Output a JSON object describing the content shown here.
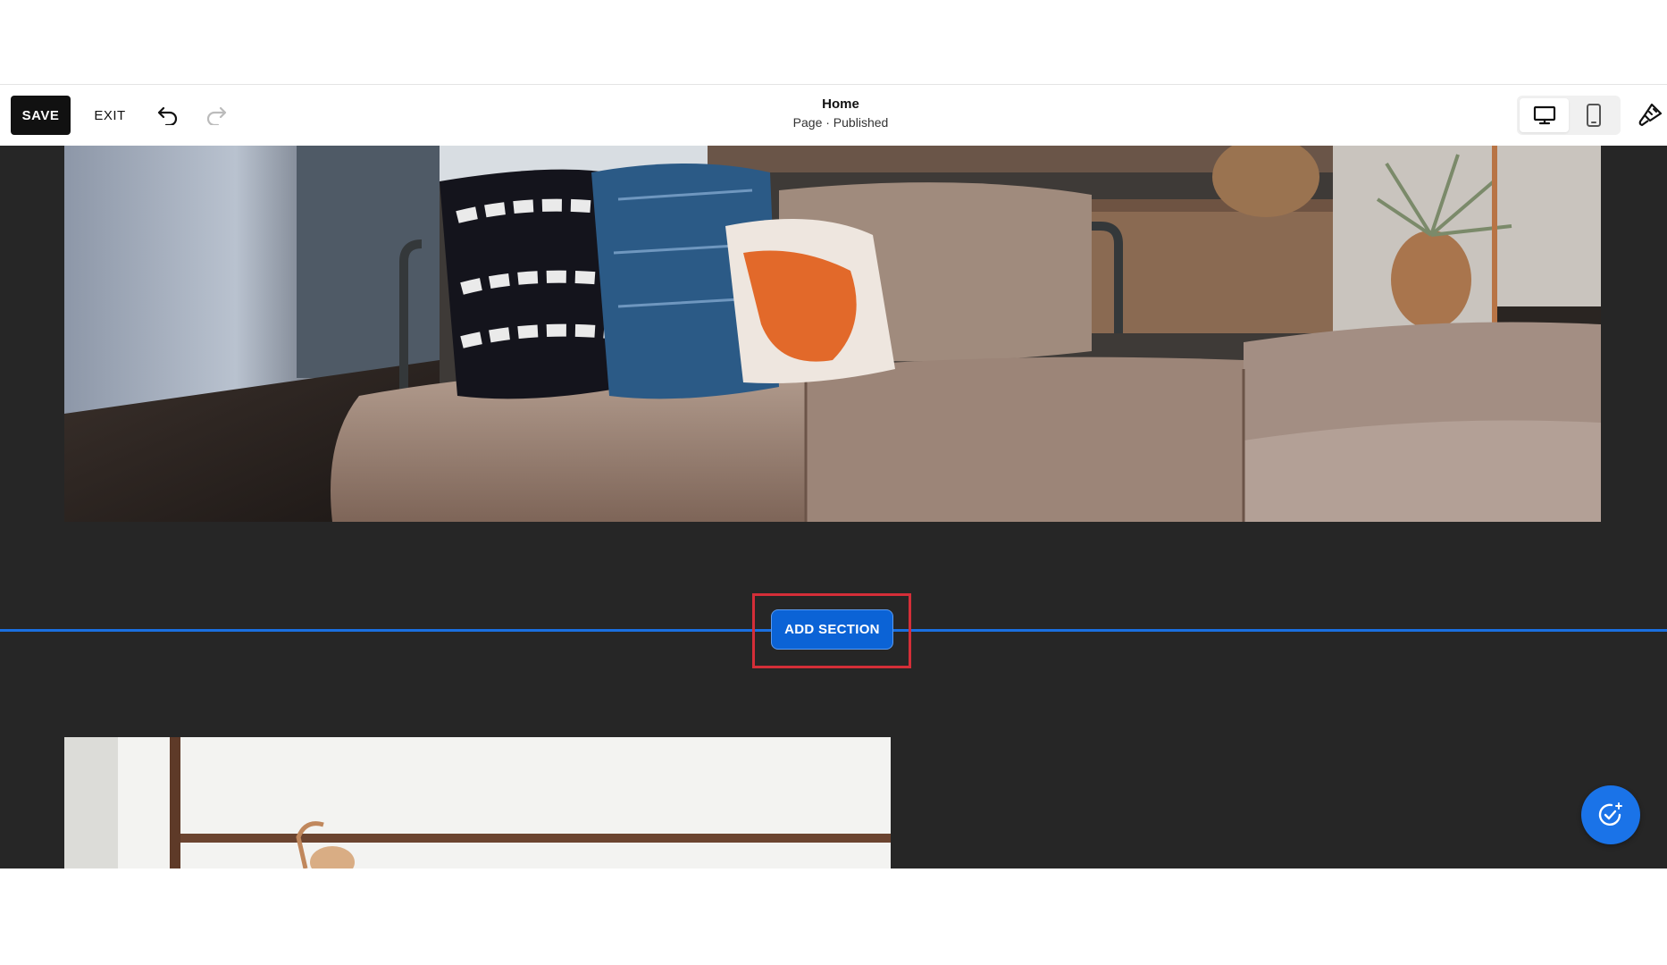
{
  "toolbar": {
    "save_label": "SAVE",
    "exit_label": "EXIT",
    "undo_icon": "undo-arrow-icon",
    "redo_icon": "redo-arrow-icon",
    "page_title": "Home",
    "page_status": "Page · Published",
    "device_modes": [
      "desktop",
      "mobile"
    ],
    "active_device": "desktop",
    "design_icon": "paintbrush-icon"
  },
  "canvas": {
    "background": "#262626",
    "add_section_label": "ADD SECTION",
    "divider_color": "#1a6fe0",
    "highlight_color": "#d42e38",
    "assistant_icon": "ai-sparkle-check-icon"
  }
}
